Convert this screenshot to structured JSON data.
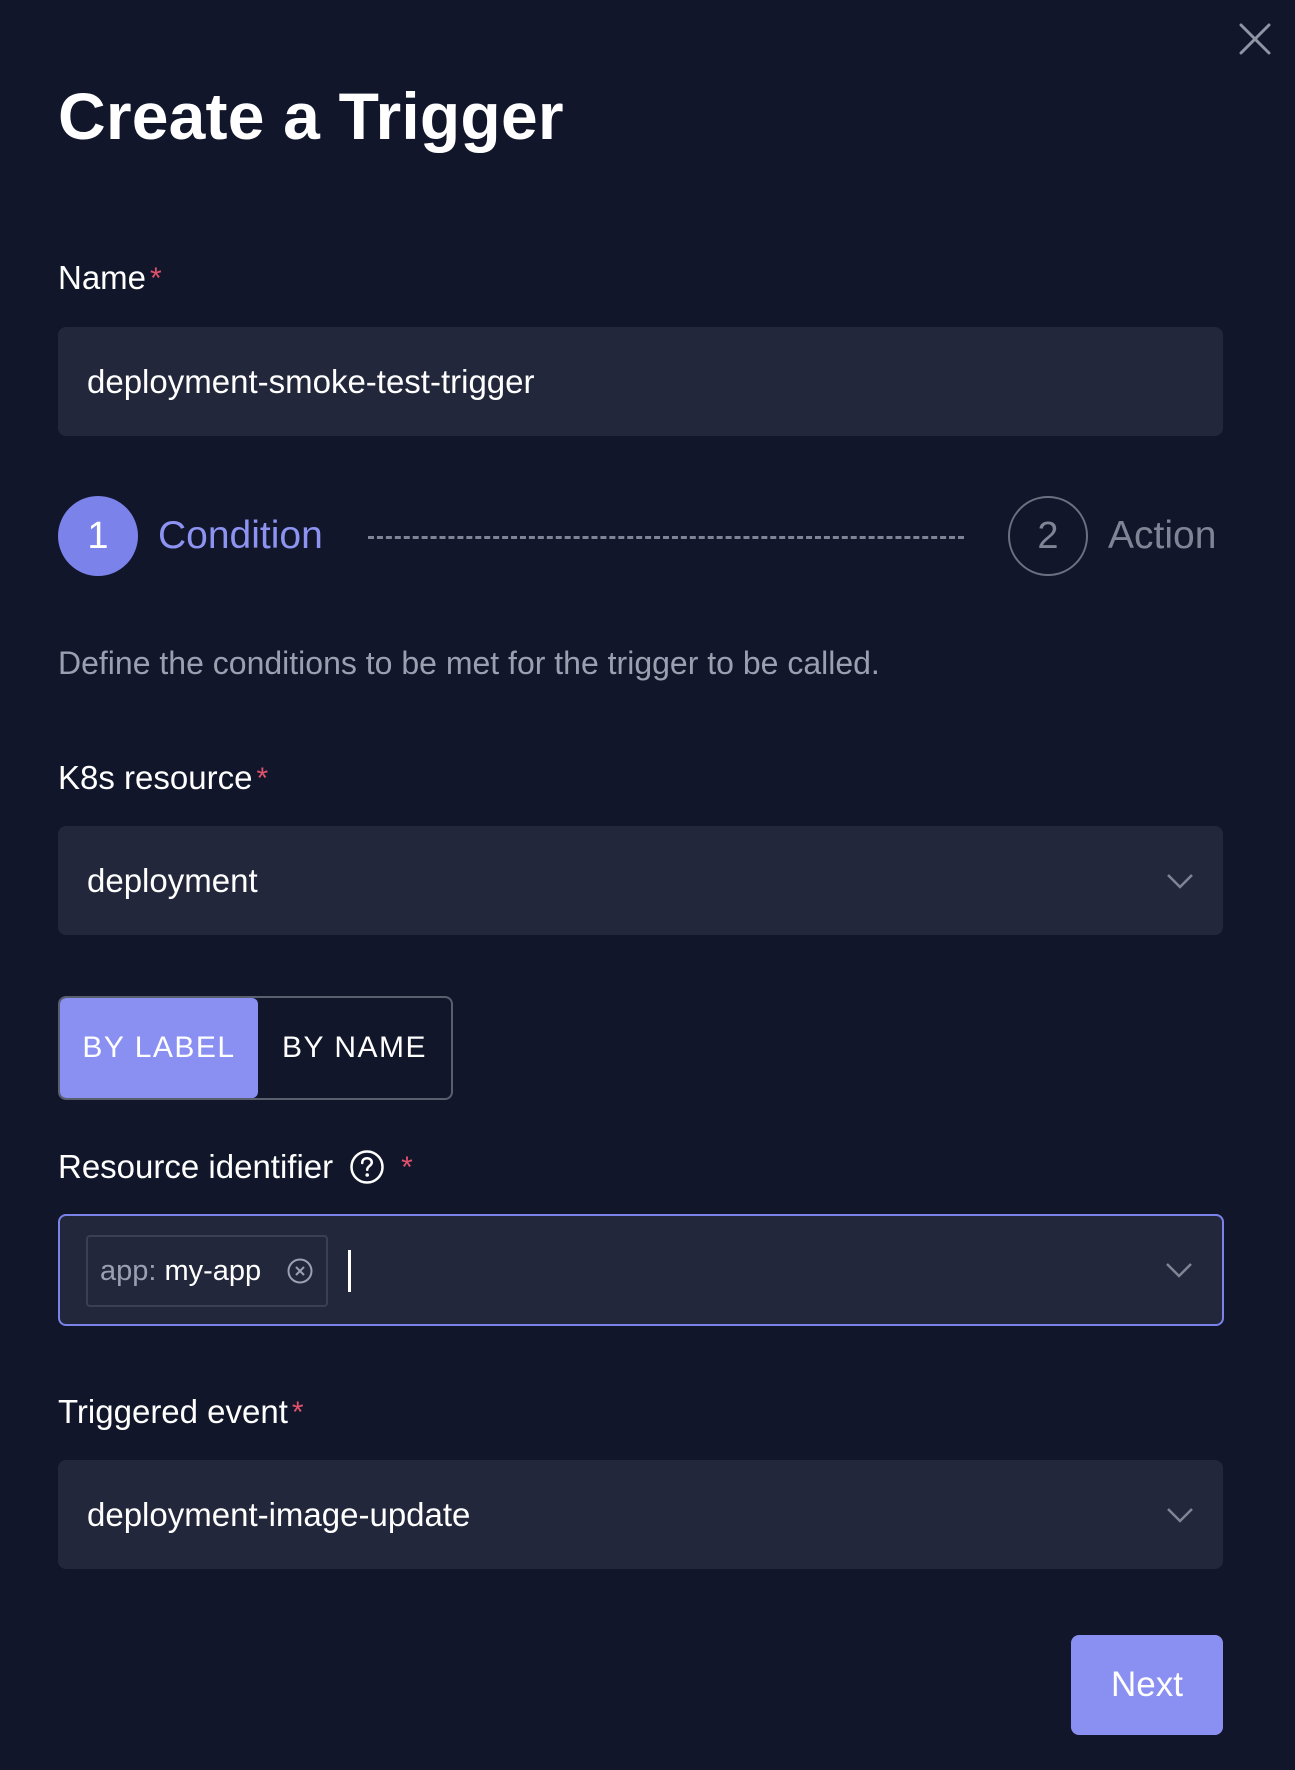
{
  "dialog": {
    "title": "Create a Trigger",
    "close_icon": "close-icon"
  },
  "name_field": {
    "label": "Name",
    "required_mark": "*",
    "value": "deployment-smoke-test-trigger"
  },
  "stepper": {
    "steps": [
      {
        "number": "1",
        "label": "Condition",
        "state": "active"
      },
      {
        "number": "2",
        "label": "Action",
        "state": "inactive"
      }
    ]
  },
  "description": "Define the conditions to be met for the trigger to be called.",
  "k8s_resource": {
    "label": "K8s resource",
    "required_mark": "*",
    "selected": "deployment"
  },
  "identifier_mode": {
    "options": [
      "BY LABEL",
      "BY NAME"
    ],
    "selected": "BY LABEL"
  },
  "resource_identifier": {
    "label": "Resource identifier",
    "required_mark": "*",
    "help_icon": "help-circle-icon",
    "tags": [
      {
        "key": "app:",
        "value": "my-app"
      }
    ]
  },
  "triggered_event": {
    "label": "Triggered event",
    "required_mark": "*",
    "selected": "deployment-image-update"
  },
  "actions": {
    "next_label": "Next"
  },
  "colors": {
    "background": "#11162a",
    "field_background": "#22273b",
    "accent": "#8a90f2",
    "required": "#e0526b",
    "muted_text": "#9aa0b0"
  }
}
